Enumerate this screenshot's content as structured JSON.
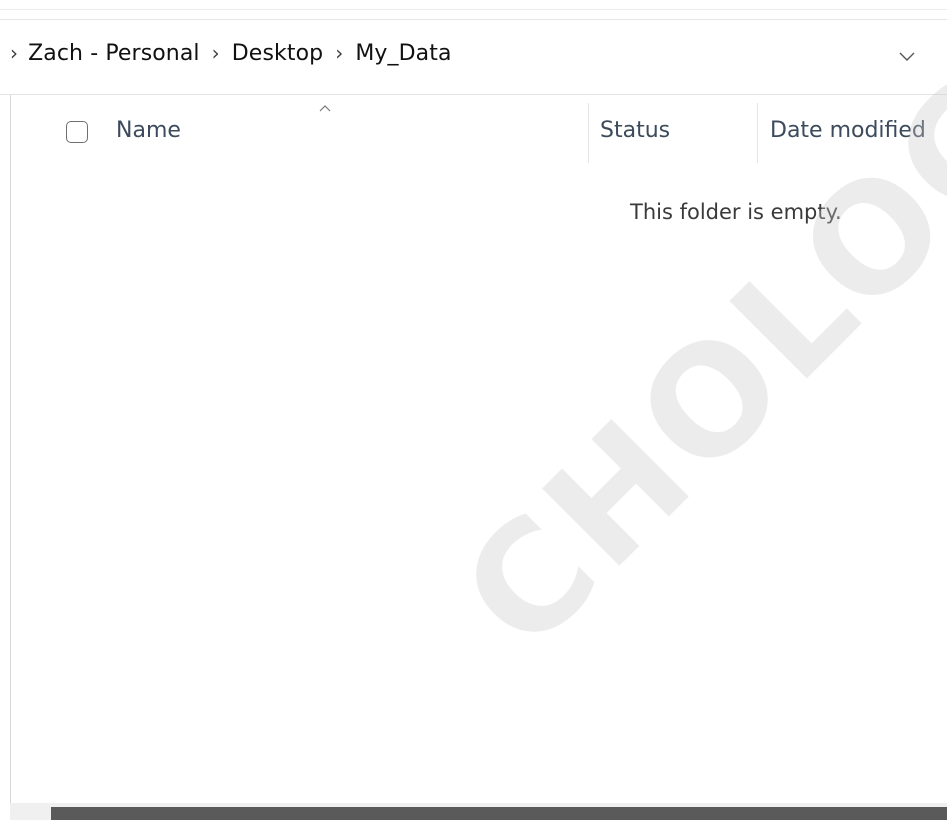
{
  "breadcrumb": {
    "items": [
      "Zach - Personal",
      "Desktop",
      "My_Data"
    ]
  },
  "columns": {
    "name": "Name",
    "status": "Status",
    "date_modified": "Date modified"
  },
  "empty_message": "This folder is empty.",
  "watermark_text": "CHOLOGY",
  "icons": {
    "breadcrumb_separator": "chevron-right-icon",
    "address_dropdown": "chevron-down-icon",
    "sort_indicator": "sort-ascending-caret-icon"
  },
  "colors": {
    "header_text": "#3c4a5c",
    "scroll_thumb": "#5a5a5a"
  }
}
